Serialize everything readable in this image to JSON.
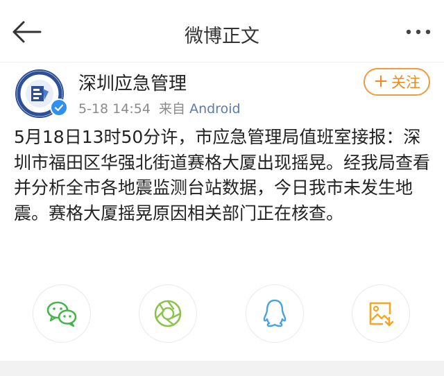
{
  "header": {
    "title": "微博正文"
  },
  "post": {
    "author": "深圳应急管理",
    "date": "5-18 14:54",
    "source_prefix": "来自",
    "source": "Android",
    "follow_label": "关注",
    "text": "5月18日13时50分许，市应急管理局值班室接报：深圳市福田区华强北街道赛格大厦出现摇晃。经我局查看并分析全市各地震监测台站数据，今日我市未发生地震。赛格大厦摇晃原因相关部门正在核查。"
  },
  "share": [
    {
      "icon": "wechat-icon",
      "color": "#44b549"
    },
    {
      "icon": "moments-icon",
      "color": "#8bc34a"
    },
    {
      "icon": "qq-icon",
      "color": "#4aa3df"
    },
    {
      "icon": "save-image-icon",
      "color": "#f5a623"
    }
  ],
  "colors": {
    "accent": "#f08a1c",
    "verified": "#2f8ff2",
    "source_link": "#5b7ba8"
  }
}
